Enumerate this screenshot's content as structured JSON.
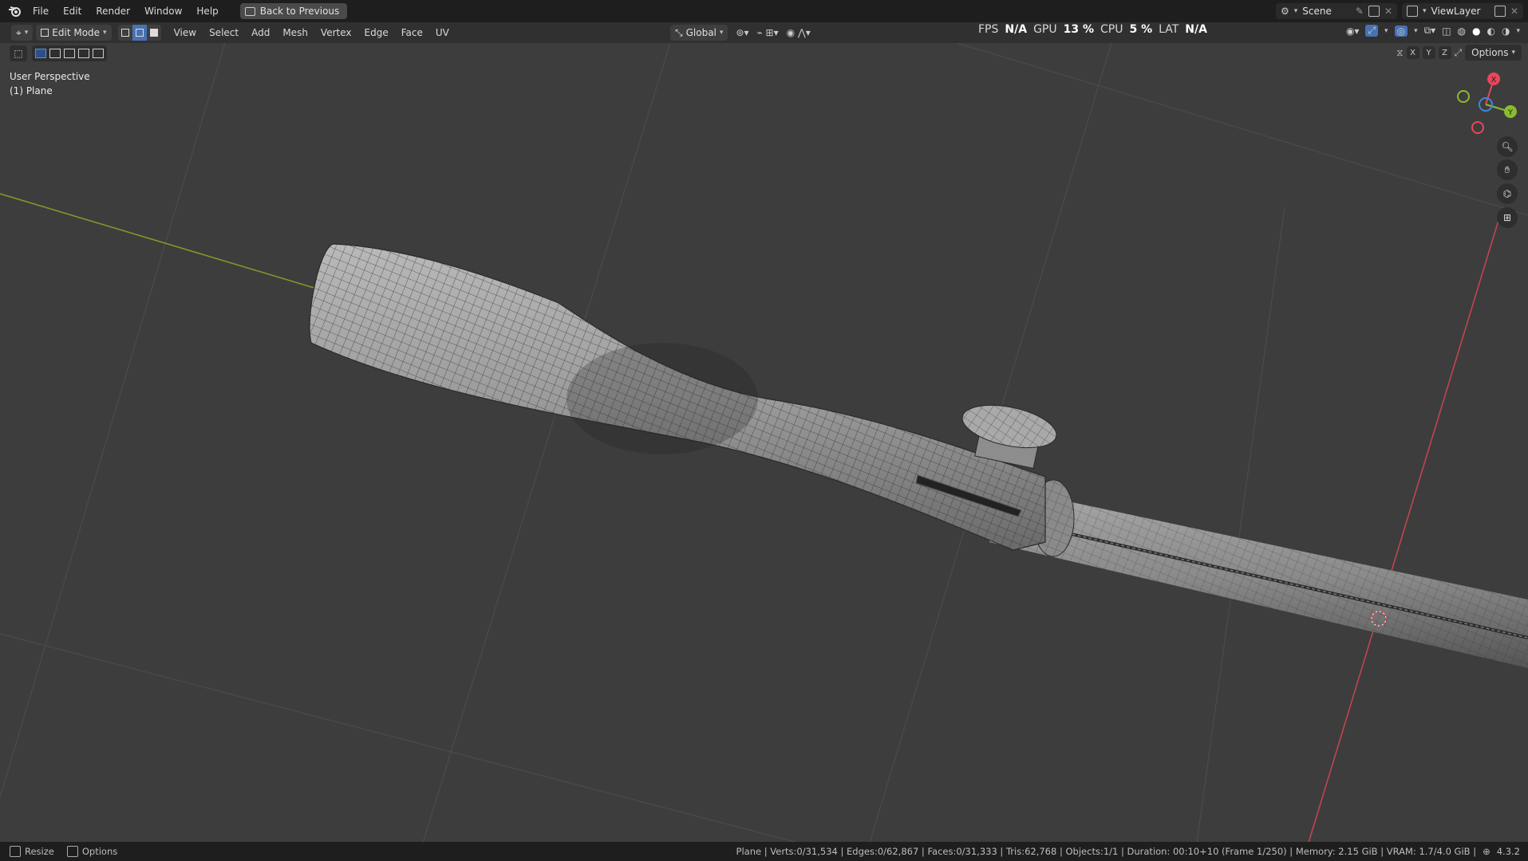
{
  "topbar": {
    "menu": [
      "File",
      "Edit",
      "Render",
      "Window",
      "Help"
    ],
    "back_button": "Back to Previous",
    "scene_label": "Scene",
    "viewlayer_label": "ViewLayer"
  },
  "header": {
    "mode": "Edit Mode",
    "menu": [
      "View",
      "Select",
      "Add",
      "Mesh",
      "Vertex",
      "Edge",
      "Face",
      "UV"
    ],
    "orientation": "Global",
    "options_label": "Options",
    "axes": [
      "X",
      "Y",
      "Z"
    ]
  },
  "stats": {
    "fps_label": "FPS",
    "fps_value": "N/A",
    "gpu_label": "GPU",
    "gpu_value": "13 %",
    "cpu_label": "CPU",
    "cpu_value": "5 %",
    "lat_label": "LAT",
    "lat_value": "N/A"
  },
  "viewport": {
    "view_name": "User Perspective",
    "object_name": "(1) Plane",
    "gizmo": {
      "x": "X",
      "y": "Y"
    }
  },
  "statusbar": {
    "left_items": [
      "Resize",
      "Options"
    ],
    "info": "Plane | Verts:0/31,534 | Edges:0/62,867 | Faces:0/31,333 | Tris:62,768 | Objects:1/1 | Duration: 00:10+10 (Frame 1/250) | Memory: 2.15 GiB | VRAM: 1.7/4.0 GiB |",
    "version": "4.3.2"
  },
  "colors": {
    "x_axis": "#e8475b",
    "y_axis": "#8cbb2e",
    "z_axis": "#3f86e0",
    "active": "#4772b3"
  }
}
